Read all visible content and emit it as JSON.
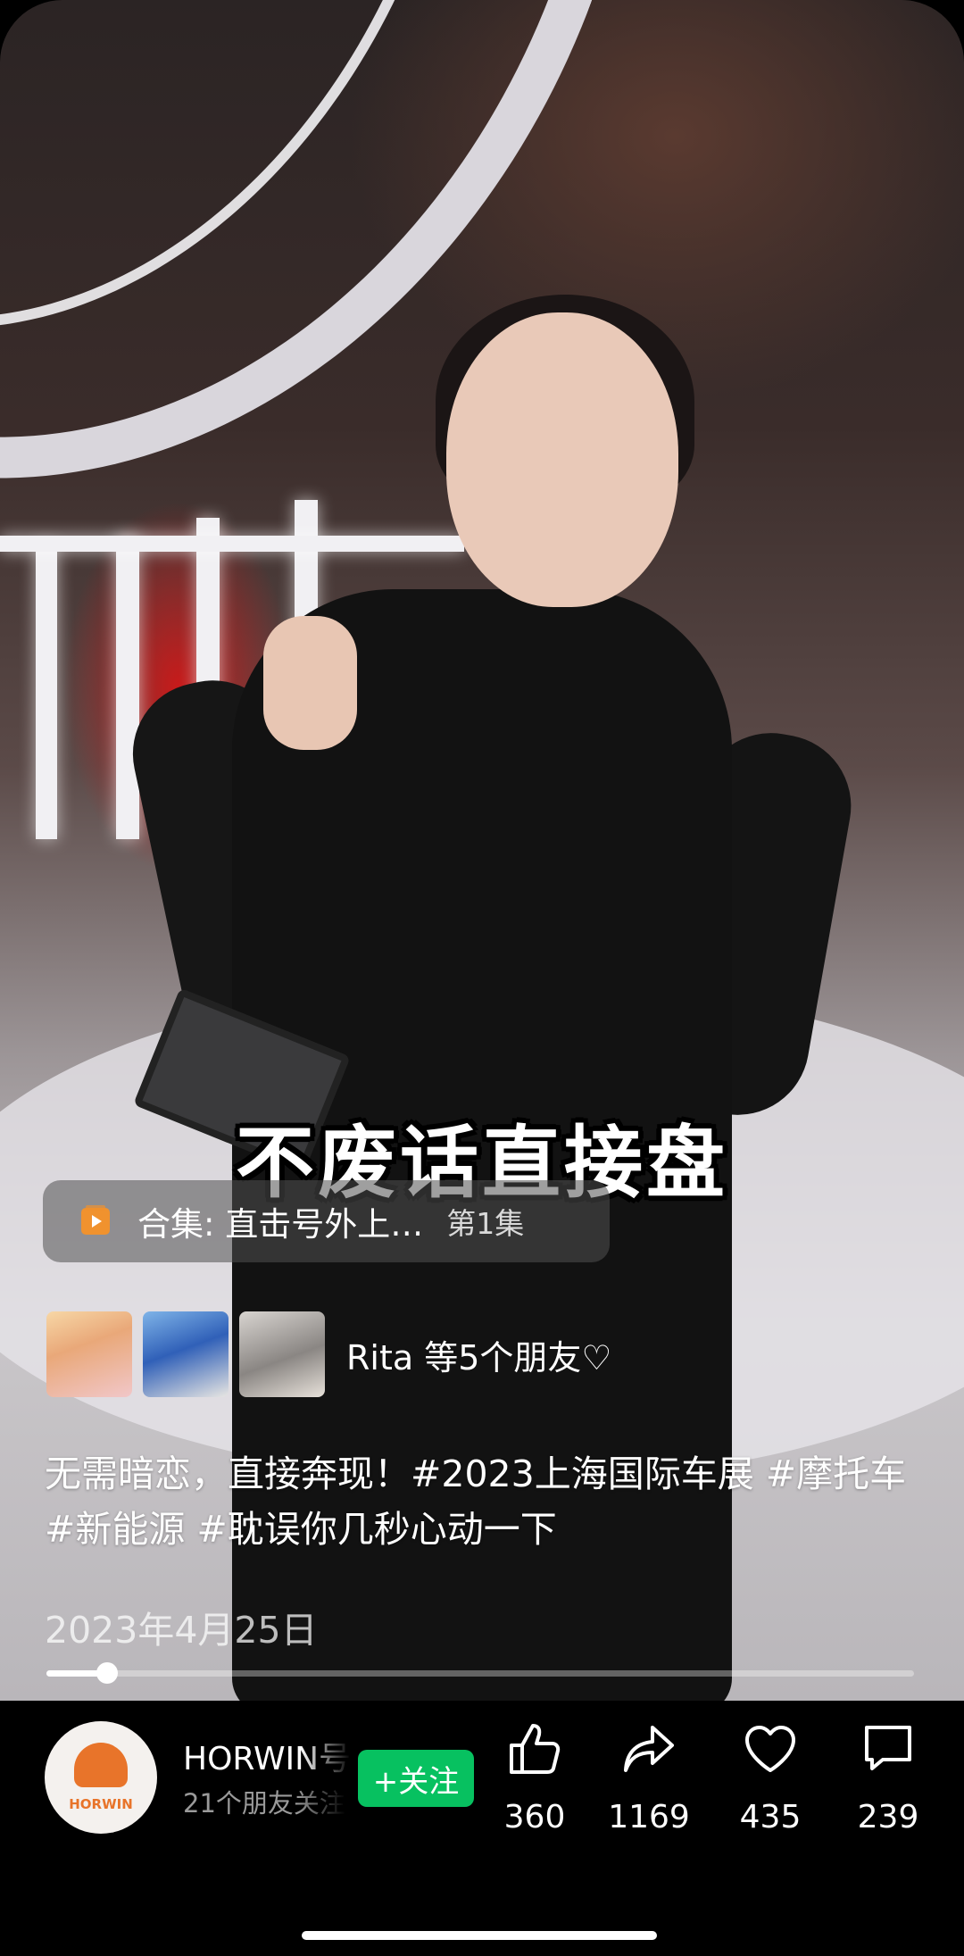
{
  "video": {
    "caption": "不废话直接盘"
  },
  "collection": {
    "label": "合集: 直击号外上…",
    "episode": "第1集",
    "icon": "collection-play-icon",
    "icon_color": "#f0922e"
  },
  "friends": {
    "text": "Rita 等5个朋友♡"
  },
  "description": "无需暗恋，直接奔现！#2023上海国际车展 #摩托车 #新能源 #耽误你几秒心动一下",
  "date": "2023年4月25日",
  "progress": {
    "fraction": 0.07
  },
  "account": {
    "name": "HORWIN号",
    "subtitle": "21个朋友关注",
    "logo_text": "HORWIN",
    "follow_label": "+关注",
    "follow_color": "#07c160"
  },
  "actions": [
    {
      "icon": "thumbs-up-icon",
      "count": "360"
    },
    {
      "icon": "share-icon",
      "count": "1169"
    },
    {
      "icon": "heart-icon",
      "count": "435"
    },
    {
      "icon": "comment-icon",
      "count": "239"
    }
  ]
}
